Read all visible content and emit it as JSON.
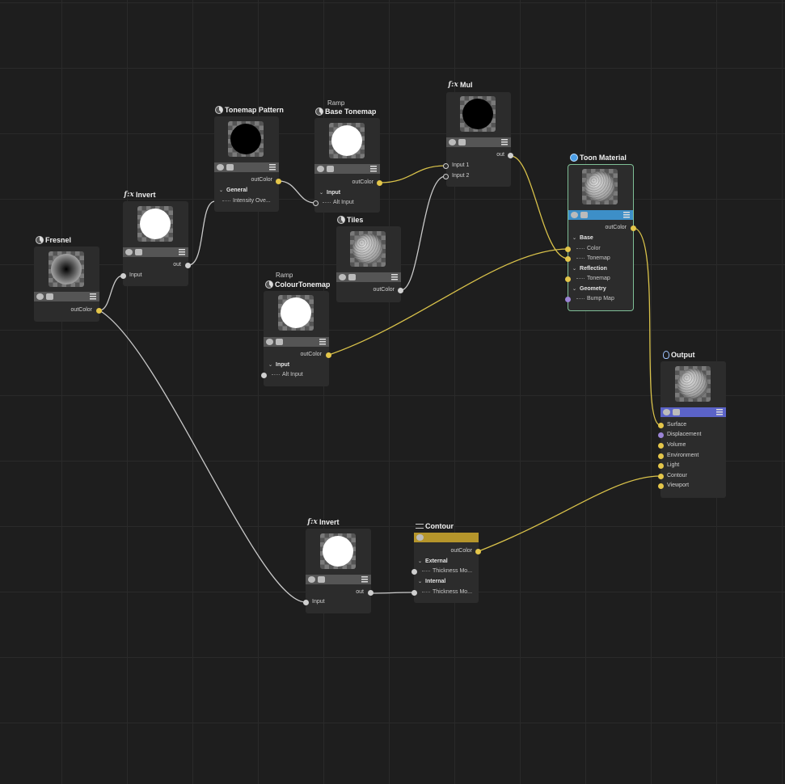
{
  "colors": {
    "canvas": "#1e1e1e",
    "node": "#2c2c2c",
    "wire_white": "#c9c9c9",
    "wire_yellow": "#d9c24a",
    "selected_outline": "#7fbf96",
    "bar_blue": "#3d8fc8",
    "bar_violet": "#5b63c8",
    "bar_gold": "#b5952b"
  },
  "nodes": {
    "fresnel": {
      "title": "Fresnel",
      "icon": "pattern-icon",
      "out": "outColor"
    },
    "invert1": {
      "title": "Invert",
      "icon": "fx-icon",
      "fx": "f:x",
      "in": "Input",
      "out": "out"
    },
    "tonemap_pattern": {
      "title": "Tonemap Pattern",
      "icon": "pattern-icon",
      "out": "outColor",
      "group": "General",
      "field": "Intensity Ove..."
    },
    "base_tonemap": {
      "super": "Ramp",
      "title": "Base Tonemap",
      "icon": "pattern-icon",
      "out": "outColor",
      "group": "Input",
      "field": "Alt Input"
    },
    "tiles": {
      "title": "Tiles",
      "icon": "pattern-icon",
      "out": "outColor"
    },
    "colour_tonemap": {
      "super": "Ramp",
      "title": "ColourTonemap",
      "icon": "pattern-icon",
      "out": "outColor",
      "group": "Input",
      "field": "Alt Input"
    },
    "mul": {
      "title": "Mul",
      "icon": "fx-icon",
      "fx": "f:x",
      "out": "out",
      "in1": "Input 1",
      "in2": "Input 2"
    },
    "toon_material": {
      "title": "Toon Material",
      "icon": "material-icon",
      "out": "outColor",
      "base": "Base",
      "color": "Color",
      "tonemap": "Tonemap",
      "reflection": "Reflection",
      "tonemap2": "Tonemap",
      "geometry": "Geometry",
      "bump": "Bump Map"
    },
    "output": {
      "title": "Output",
      "icon": "output-icon",
      "inputs": [
        "Surface",
        "Displacement",
        "Volume",
        "Environment",
        "Light",
        "Contour",
        "Viewport"
      ]
    },
    "invert2": {
      "title": "Invert",
      "icon": "fx-icon",
      "fx": "f:x",
      "in": "Input",
      "out": "out"
    },
    "contour": {
      "title": "Contour",
      "icon": "contour-icon",
      "out": "outColor",
      "external": "External",
      "thick1": "Thickness Mo...",
      "internal": "Internal",
      "thick2": "Thickness Mo..."
    }
  }
}
